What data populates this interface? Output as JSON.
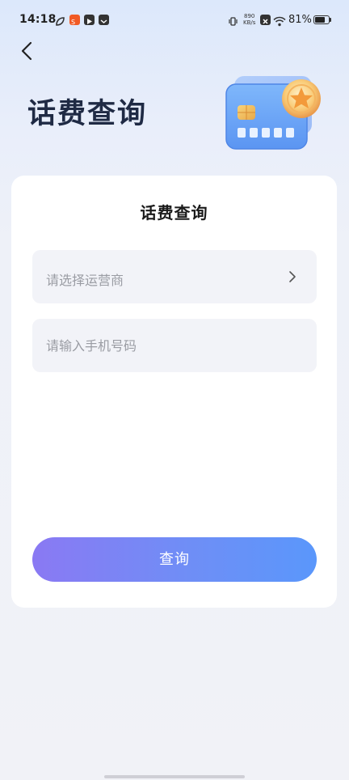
{
  "status_bar": {
    "time": "14:18",
    "net_speed_value": "890",
    "net_speed_unit": "KB/s",
    "battery_percent": "81%",
    "battery_level": 0.81
  },
  "header": {
    "title": "话费查询"
  },
  "card": {
    "title": "话费查询",
    "carrier_field": {
      "label": "请选择运营商"
    },
    "phone_field": {
      "placeholder": "请输入手机号码",
      "value": ""
    },
    "submit_label": "查询"
  },
  "colors": {
    "accent_start": "#8a79f3",
    "accent_end": "#5a97fb",
    "title_text": "#1f2a44",
    "placeholder_text": "#9a9ca3"
  },
  "icons": {
    "back": "chevron-left-icon",
    "carrier_select": "chevron-right-icon",
    "hero": "credit-card-star-icon"
  }
}
